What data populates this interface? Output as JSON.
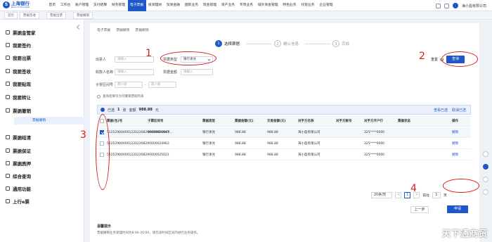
{
  "header": {
    "logo_cn": "上海银行",
    "logo_en": "Bank of Shanghai",
    "nav": [
      "首页",
      "工作台",
      "账户管理",
      "支付结算",
      "财务管理",
      "电子票据",
      "投资理财",
      "贸易金融",
      "国际业务",
      "现金管理",
      "资产业务",
      "专项业务",
      "境外资金管理",
      "特色业务",
      "托管业务",
      "企业管理"
    ],
    "active_nav": "电子票据",
    "company": "海小盈有限公司"
  },
  "tabs": [
    "首页",
    "票据签收",
    "票据出票",
    "票据撤销"
  ],
  "sidebar": {
    "items": [
      "票据金管家",
      "我要签约",
      "我要出票",
      "我要签收",
      "我要贴现",
      "我要转让",
      "票据撤销",
      "票据结清",
      "票据保证",
      "票据质押",
      "综合查询",
      "通用功能",
      "上行e票"
    ],
    "sub_item": "票据撤销"
  },
  "breadcrumb": [
    "电子票据",
    "票据撤销",
    "票据撤销"
  ],
  "steps": [
    {
      "num": "1",
      "label": "选择票据"
    },
    {
      "num": "2",
      "label": "确认信息"
    },
    {
      "num": "3",
      "label": "完成"
    }
  ],
  "form": {
    "drawer_label": "出票人",
    "drawer_placeholder": "请输入",
    "bill_type_label": "票据类型",
    "bill_type_value": "银行承兑",
    "payee_label": "收款人名称",
    "payee_placeholder": "请输入",
    "amount_label": "票据金额",
    "amount_placeholder": "请输入",
    "sub_range_label": "子票区间号",
    "min_placeholder": "最小值",
    "max_placeholder": "最小值",
    "reset_label": "重置",
    "query_label": "查询"
  },
  "hint": "查询结果仅为可撤销票据列表",
  "selection": {
    "selected_label": "已选",
    "selected_count": "1",
    "unit": "张",
    "total_label": "金额",
    "total_amount": "988.88",
    "unit_yuan": "元",
    "view_selected": "查看已选",
    "clear_selected": "取消已选"
  },
  "table": {
    "columns": [
      "票据(包)号",
      "子票区间号",
      "票据类型",
      "票据金额(元)",
      "交易金额(元)",
      "对手方名称",
      "对手方账号",
      "对手方开户行",
      "票据状态",
      "操作"
    ],
    "rows": [
      {
        "no": "5225290000012202308290000024947",
        "range": "00000000000...",
        "type": "银行承兑",
        "amount": "988.88",
        "trade": "988.88",
        "party": "海小盈有限公司",
        "acct": "",
        "bank": "325****0000",
        "status": "",
        "op": "撤销",
        "checked": true
      },
      {
        "no": "5225290000012202308290000024963",
        "range": "",
        "type": "银行承兑",
        "amount": "988.88",
        "trade": "988.88",
        "party": "海小盈有限公司",
        "acct": "",
        "bank": "325****0000",
        "status": "",
        "op": "撤销",
        "checked": false
      },
      {
        "no": "5225290000012202308290000025021",
        "range": "",
        "type": "银行承兑",
        "amount": "988.88",
        "trade": "988.88",
        "party": "海小盈有限公司",
        "acct": "",
        "bank": "325****0000",
        "status": "",
        "op": "撤销",
        "checked": false
      }
    ]
  },
  "pager": {
    "page_size": "20条/页",
    "prev": "<",
    "current": "1",
    "next": ">",
    "goto_label": "前往",
    "goto_value": "1",
    "page_unit": "页"
  },
  "actions": {
    "prev_step": "上一步",
    "apply": "申请"
  },
  "tips": {
    "title": "温馨提示",
    "text": "票据撤销业务受理时间为8:00-20:00，请在该时间区间内进行业务操作。"
  },
  "annotations": [
    "1",
    "2",
    "3",
    "4"
  ],
  "watermark": "天下通商贸",
  "colors": {
    "primary": "#1e57c8",
    "annotation": "#d21f1f"
  }
}
